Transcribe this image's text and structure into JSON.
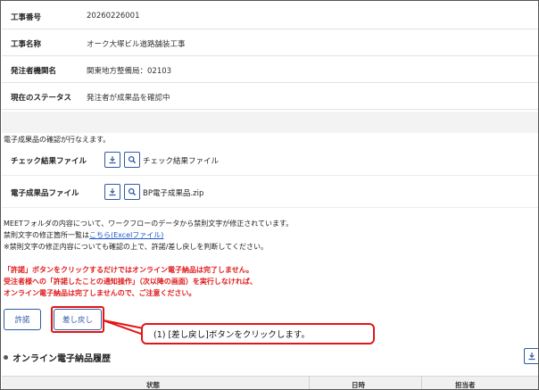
{
  "info": [
    {
      "label": "工事番号",
      "value": "20260226001"
    },
    {
      "label": "工事名称",
      "value": "オーク大塚ビル道路舗装工事"
    },
    {
      "label": "発注者機関名",
      "value": "関東地方整備局：02103"
    },
    {
      "label": "現在のステータス",
      "value": "発注者が成果品を確認中"
    }
  ],
  "confirm_note": "電子成果品の確認が行なえます。",
  "files": [
    {
      "label": "チェック結果ファイル",
      "name": "チェック結果ファイル"
    },
    {
      "label": "電子成果品ファイル",
      "name": "BP電子成果品.zip"
    }
  ],
  "notes": {
    "line1": "MEETフォルダの内容について、ワークフローのデータから禁則文字が修正されています。",
    "line2_prefix": "禁則文字の修正箇所一覧は",
    "line2_link": "こちら(Excelファイル)",
    "line3": "※禁則文字の修正内容についても確認の上で、許諾/差し戻しを判断してください。"
  },
  "warning": {
    "line1": "「許諾」ボタンをクリックするだけではオンライン電子納品は完了しません。",
    "line2": "受注者様への「許諾したことの通知操作」（次以降の画面）を実行しなければ、",
    "line3": "オンライン電子納品は完了しませんので、ご注意ください。"
  },
  "buttons": {
    "approve": "許諾",
    "send_back": "差し戻し"
  },
  "callout": "(1) [差し戻し]ボタンをクリックします。",
  "history": {
    "title": "オンライン電子納品履歴",
    "columns": [
      "状態",
      "日時",
      "担当者"
    ]
  },
  "colors": {
    "accent": "#2f5aa8",
    "warning": "#e01b1b",
    "highlight": "#e21616"
  }
}
